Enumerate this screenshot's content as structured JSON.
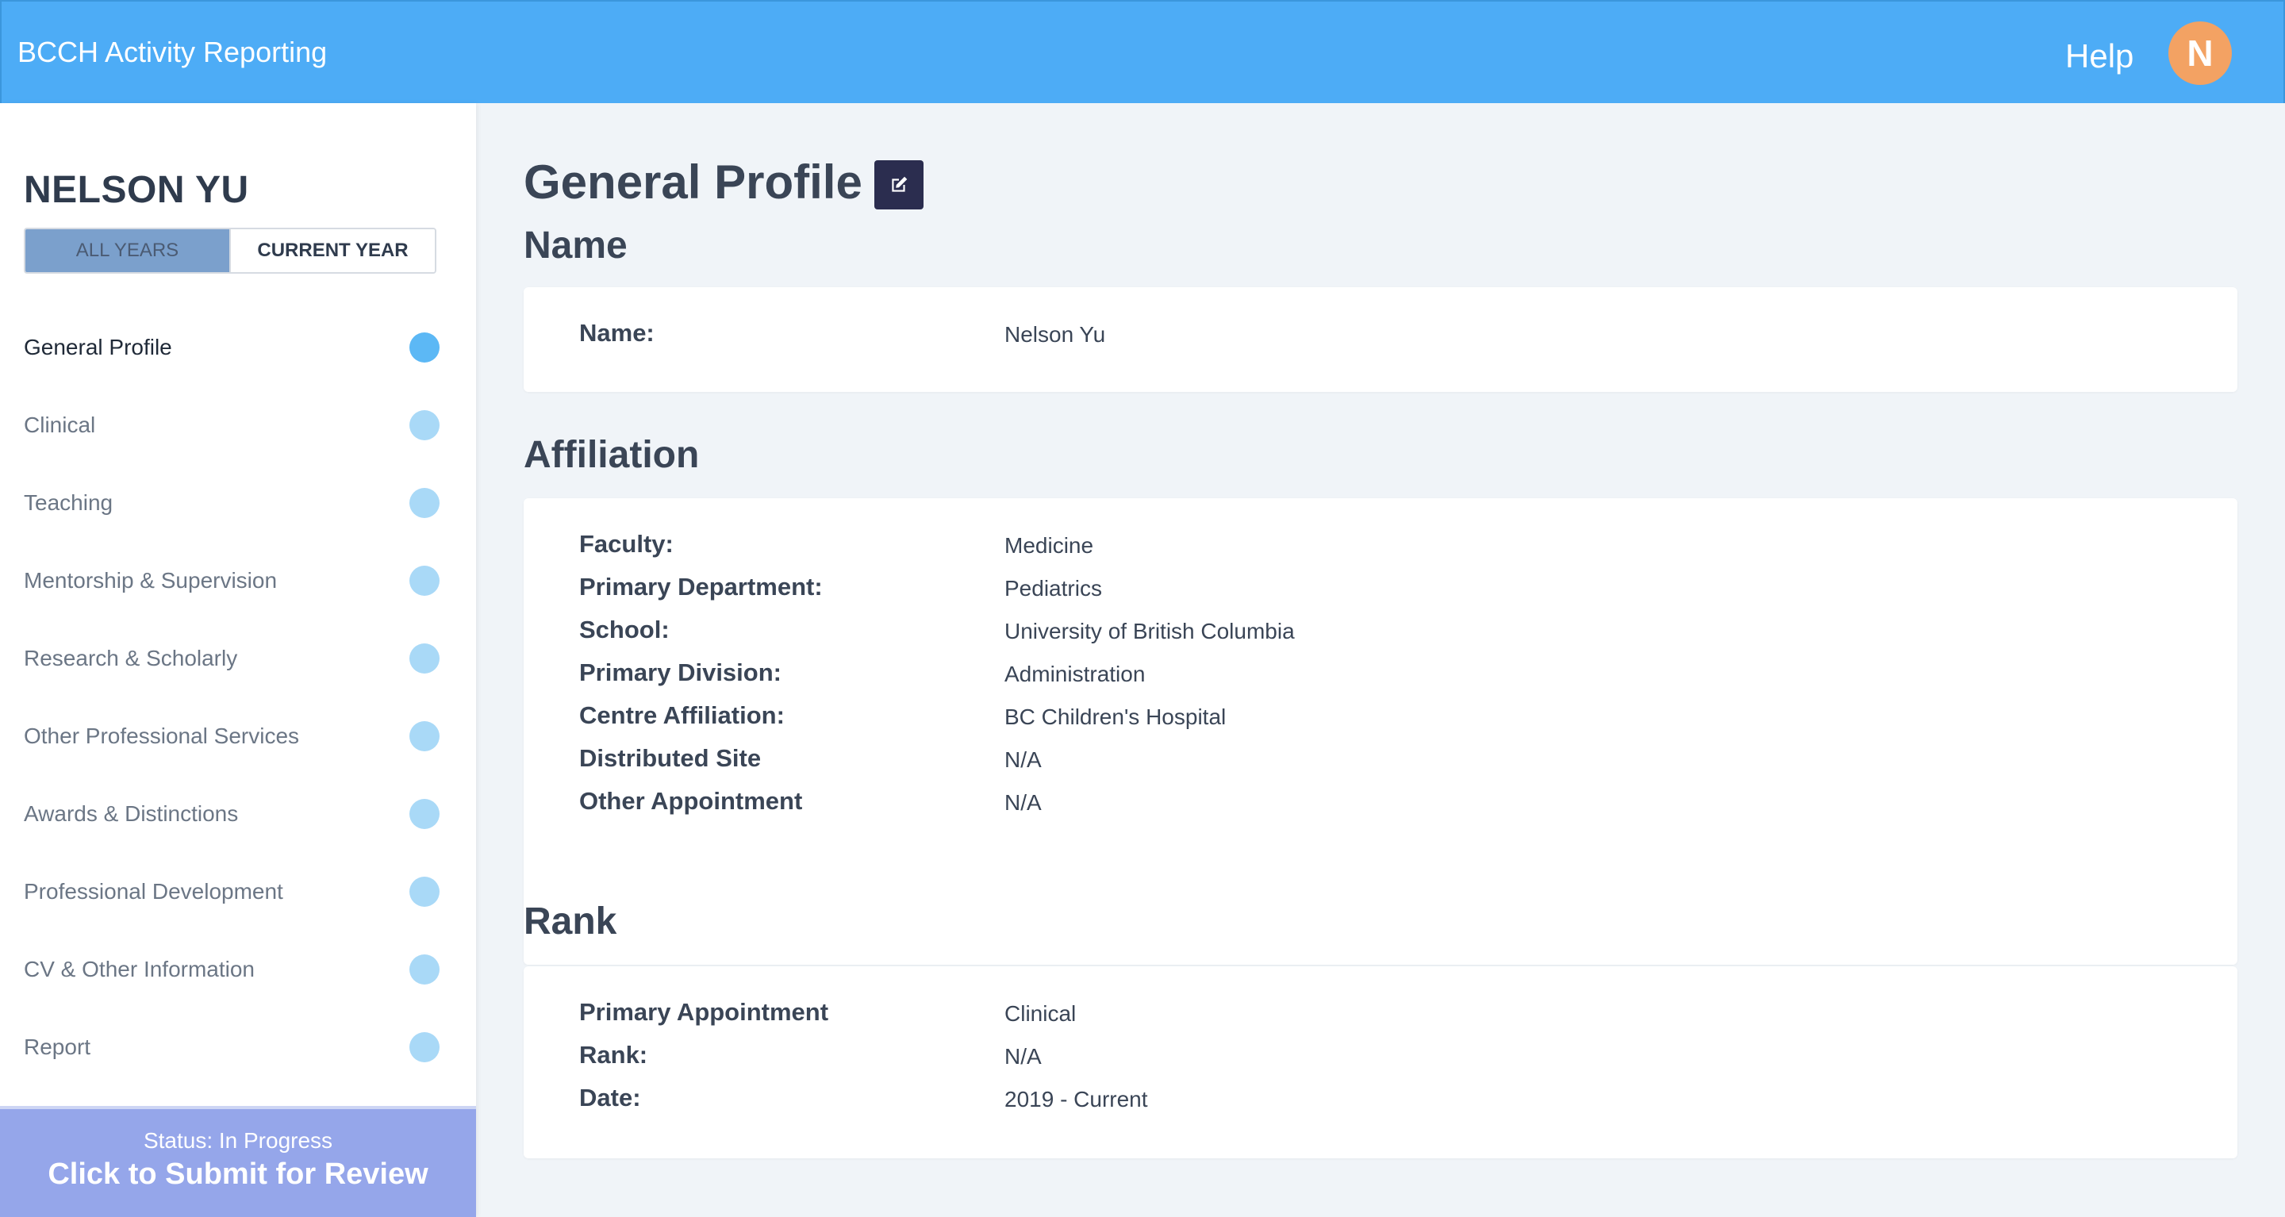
{
  "header": {
    "app_title": "BCCH Activity Reporting",
    "help_label": "Help",
    "avatar_initial": "N",
    "avatar_color": "#f3a263",
    "bar_color": "#4dacf6"
  },
  "sidebar": {
    "user_name": "NELSON YU",
    "year_toggle": {
      "all_years_label": "ALL YEARS",
      "current_year_label": "CURRENT YEAR",
      "selected": "ALL YEARS"
    },
    "nav_items": [
      {
        "label": "General Profile",
        "active": true
      },
      {
        "label": "Clinical",
        "active": false
      },
      {
        "label": "Teaching",
        "active": false
      },
      {
        "label": "Mentorship & Supervision",
        "active": false
      },
      {
        "label": "Research & Scholarly",
        "active": false
      },
      {
        "label": "Other Professional Services",
        "active": false
      },
      {
        "label": "Awards & Distinctions",
        "active": false
      },
      {
        "label": "Professional Development",
        "active": false
      },
      {
        "label": "CV & Other Information",
        "active": false
      },
      {
        "label": "Report",
        "active": false
      }
    ],
    "submit": {
      "status_text": "Status: In Progress",
      "button_label": "Click to Submit for Review",
      "color": "#95a6ea"
    }
  },
  "main": {
    "page_title": "General Profile",
    "edit_icon": "edit-icon",
    "sections": {
      "name": {
        "title": "Name",
        "rows": [
          {
            "label": "Name:",
            "value": "Nelson Yu"
          }
        ]
      },
      "affiliation": {
        "title": "Affiliation",
        "rows": [
          {
            "label": "Faculty:",
            "value": "Medicine"
          },
          {
            "label": "Primary Department:",
            "value": "Pediatrics"
          },
          {
            "label": "School:",
            "value": "University of British Columbia"
          },
          {
            "label": "Primary Division:",
            "value": "Administration"
          },
          {
            "label": "Centre Affiliation:",
            "value": "BC Children's Hospital"
          },
          {
            "label": "Distributed Site",
            "value": "N/A"
          },
          {
            "label": "Other Appointment",
            "value": "N/A"
          }
        ]
      },
      "rank": {
        "title": "Rank",
        "rows": [
          {
            "label": "Primary Appointment",
            "value": "Clinical"
          },
          {
            "label": "Rank:",
            "value": "N/A"
          },
          {
            "label": "Date:",
            "value": "2019 - Current"
          }
        ]
      }
    }
  }
}
